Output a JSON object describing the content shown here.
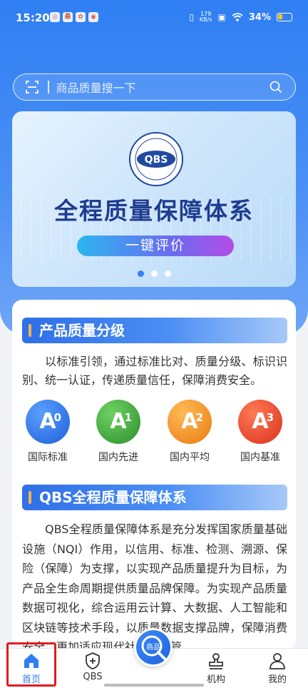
{
  "status_bar": {
    "time": "15:20",
    "speed_value": "179",
    "speed_unit": "KB/s",
    "battery_percent": "34%",
    "battery_level": 0.34
  },
  "search": {
    "placeholder": "商品质量搜一下"
  },
  "banner": {
    "logo_text": "QBS",
    "title": "全程质量保障体系",
    "button_label": "一键评价",
    "dots": 3,
    "active_dot": 0
  },
  "section1": {
    "title": "产品质量分级",
    "paragraph": "以标准引领，通过标准比对、质量分级、标识识别、统一认证，传递质量信任，保障消费安全。",
    "grades": [
      {
        "letter": "A",
        "sup": "0",
        "label": "国际标准",
        "color": "#2f75e8"
      },
      {
        "letter": "A",
        "sup": "1",
        "label": "国内先进",
        "color": "#3fa83a"
      },
      {
        "letter": "A",
        "sup": "2",
        "label": "国内平均",
        "color": "#f28a1c"
      },
      {
        "letter": "A",
        "sup": "3",
        "label": "国内基准",
        "color": "#e5402a"
      }
    ]
  },
  "section2": {
    "title": "QBS全程质量保障体系",
    "paragraph": "QBS全程质量保障体系是充分发挥国家质量基础设施（NQI）作用，以信用、标准、检测、溯源、保险（保障）为支撑，以实现产品质量提升为目标，为产品全生命周期提供质量品牌保障。为实现产品质量数据可视化，综合运用云计算、大数据、人工智能和区块链等技术手段，以质量数据支撑品牌，保障消费安全，更加适应现代社会质量管"
  },
  "bottom_nav": {
    "items": [
      {
        "label": "首页",
        "icon": "home-icon"
      },
      {
        "label": "QBS",
        "icon": "shield-plus-icon"
      },
      {
        "label": "商品",
        "icon": "search-icon"
      },
      {
        "label": "机构",
        "icon": "stamp-icon"
      },
      {
        "label": "我的",
        "icon": "person-icon"
      }
    ],
    "active": "首页"
  },
  "colors": {
    "primary": "#2f7ff3",
    "highlight_outline": "#e21b23"
  }
}
